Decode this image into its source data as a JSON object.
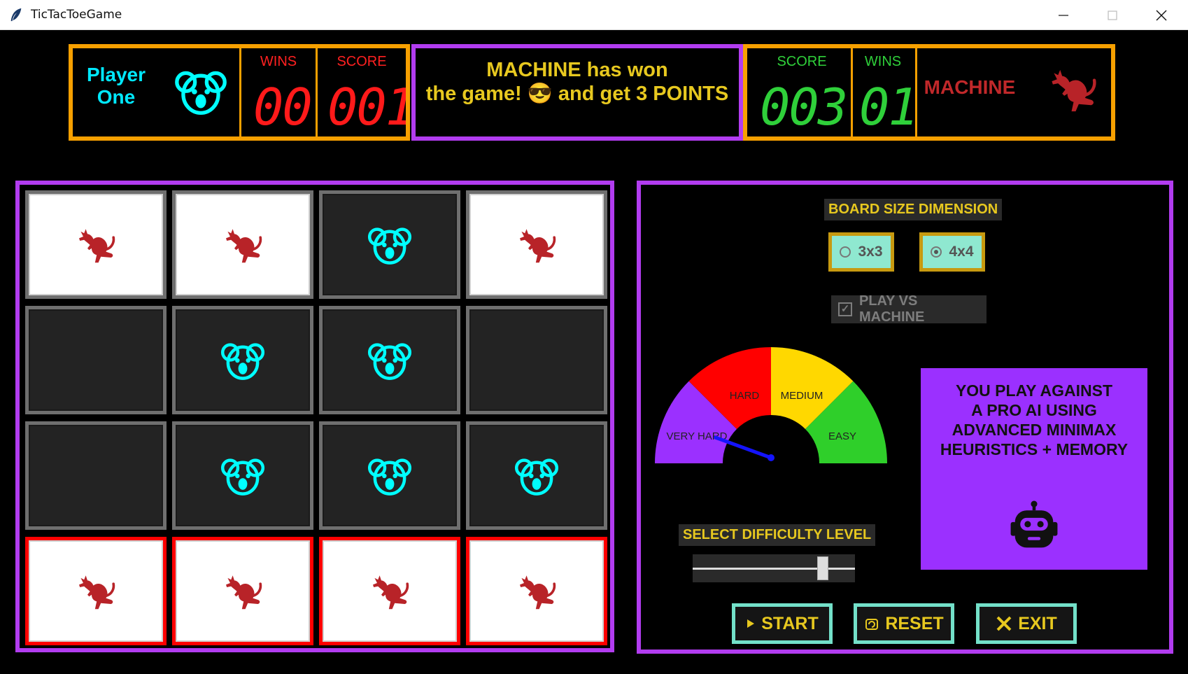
{
  "window": {
    "title": "TicTacToeGame"
  },
  "player": {
    "name_line1": "Player",
    "name_line2": "One",
    "wins_label": "WINS",
    "wins": "00",
    "score_label": "SCORE",
    "score": "001",
    "icon": "koala-icon",
    "color": "#00ffff"
  },
  "machine": {
    "name": "MACHINE",
    "wins_label": "WINS",
    "wins": "01",
    "score_label": "SCORE",
    "score": "003",
    "icon": "kangaroo-icon",
    "color": "#c0282a"
  },
  "message": {
    "line1": "MACHINE has won",
    "line2": "the game! 😎 and get 3 POINTS"
  },
  "board": {
    "cells": [
      [
        "kangaroo",
        "kangaroo",
        "koala",
        "kangaroo"
      ],
      [
        "",
        "koala",
        "koala",
        ""
      ],
      [
        "",
        "koala",
        "koala",
        "koala"
      ],
      [
        "kangaroo",
        "kangaroo",
        "kangaroo",
        "kangaroo"
      ]
    ],
    "winning_row": 3
  },
  "settings": {
    "board_size_label": "BOARD SIZE DIMENSION",
    "option_3x3": "3x3",
    "option_4x4": "4x4",
    "selected_size": "4x4",
    "play_vs_machine_label": "PLAY VS MACHINE",
    "play_vs_machine": true,
    "gauge_labels": {
      "very_hard": "VERY HARD",
      "hard": "HARD",
      "medium": "MEDIUM",
      "easy": "EASY"
    },
    "difficulty_label": "SELECT DIFFICULTY LEVEL",
    "difficulty_value": 0.85
  },
  "ai_info": {
    "text_lines": [
      "YOU PLAY AGAINST",
      "A PRO AI USING",
      "ADVANCED MINIMAX",
      "HEURISTICS + MEMORY"
    ],
    "icon": "robot-icon"
  },
  "buttons": {
    "start": "START",
    "reset": "RESET",
    "exit": "EXIT"
  },
  "colors": {
    "accent_orange": "#f7a000",
    "accent_purple": "#b23cf0",
    "text_yellow": "#e7c81f",
    "button_border": "#73e0c9",
    "win_red": "#ff0000"
  }
}
